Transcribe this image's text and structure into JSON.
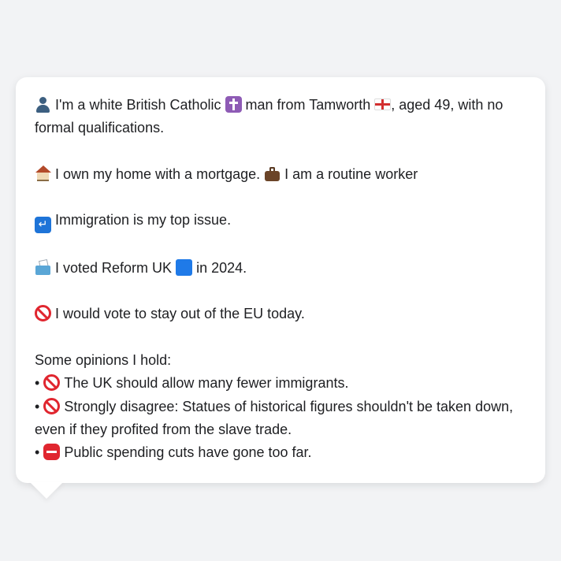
{
  "colors": {
    "background": "#f2f3f5",
    "bubble": "#ffffff",
    "text": "#1e1f22"
  },
  "profile": {
    "intro_before_cross": "I'm a white British Catholic",
    "intro_between": "man from Tamworth",
    "intro_after_flag": ", aged 49, with no formal qualifications.",
    "home_text": "I own my home with a mortgage.",
    "work_text": "I am a routine worker",
    "top_issue": "Immigration is my top issue.",
    "vote_before": "I voted Reform UK",
    "vote_after": "in 2024.",
    "eu_stance": "I would vote to stay out of the EU today.",
    "opinions_heading": "Some opinions I hold:",
    "opinions": [
      {
        "bullet": "•",
        "icon": "prohibited-icon",
        "text": "The UK should allow many fewer immigrants."
      },
      {
        "bullet": "•",
        "icon": "prohibited-icon",
        "text": "Strongly disagree: Statues of historical figures shouldn't be taken down, even if they profited from the slave trade."
      },
      {
        "bullet": "•",
        "icon": "stop-sign-icon",
        "text": "Public spending cuts have gone too far."
      }
    ]
  },
  "icons": {
    "person": "person-icon",
    "cross": "latin-cross-icon",
    "flag": "england-flag-icon",
    "house": "house-icon",
    "briefcase": "briefcase-icon",
    "passport": "passport-control-icon",
    "ballot": "ballot-box-icon",
    "party_color": "blue-square-icon",
    "eu": "prohibited-icon"
  }
}
